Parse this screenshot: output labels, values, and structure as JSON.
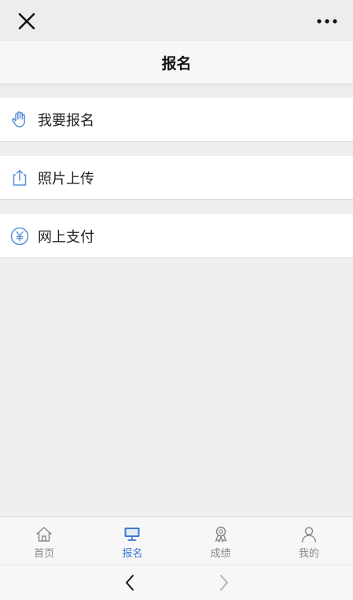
{
  "header": {
    "title": "报名",
    "close_icon": "close-icon",
    "more_icon": "more-dots-icon"
  },
  "menu": {
    "items": [
      {
        "label": "我要报名",
        "icon": "hand-icon"
      },
      {
        "label": "照片上传",
        "icon": "upload-icon"
      },
      {
        "label": "网上支付",
        "icon": "yuan-icon"
      }
    ]
  },
  "tabbar": {
    "tabs": [
      {
        "label": "首页",
        "icon": "home-icon",
        "active": false
      },
      {
        "label": "报名",
        "icon": "monitor-icon",
        "active": true
      },
      {
        "label": "成绩",
        "icon": "award-icon",
        "active": false
      },
      {
        "label": "我的",
        "icon": "user-icon",
        "active": false
      }
    ]
  },
  "colors": {
    "accent": "#3a77d0",
    "icon_blue": "#5b8fd6",
    "tab_inactive": "#888888",
    "background": "#efefef"
  }
}
